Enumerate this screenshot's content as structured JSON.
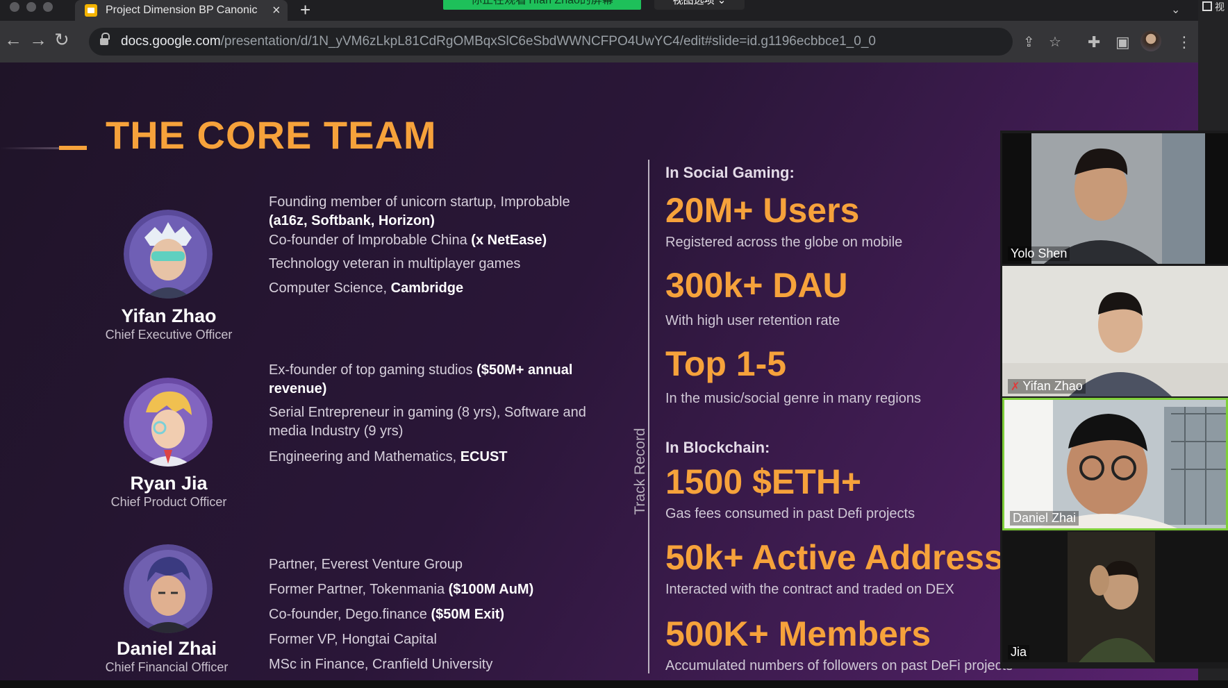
{
  "browser": {
    "tab_title": "Project Dimension BP Canonic",
    "tab_close": "×",
    "new_tab": "+",
    "share_banner": "你正在观看Yifan Zhao的屏幕",
    "view_options": "视图选项 ⌄",
    "url_host": "docs.google.com",
    "url_path": "/presentation/d/1N_yVM6zLkpL81CdRgOMBqxSlC6eSbdWWNCFPO4UwYC4/edit#slide=id.g1196ecbbce1_0_0",
    "right_strip_text": "视"
  },
  "slide": {
    "title": "THE CORE TEAM",
    "members": [
      {
        "name": "Yifan Zhao",
        "role": "Chief Executive Officer",
        "bullets": [
          {
            "text": "Founding member of unicorn startup, Improbable ",
            "bold": "(a16z, Softbank, Horizon)"
          },
          {
            "text": "Co-founder of Improbable China ",
            "bold": "(x NetEase)"
          },
          {
            "text": "Technology veteran in multiplayer games",
            "bold": ""
          },
          {
            "text": "Computer Science, ",
            "bold": "Cambridge"
          }
        ]
      },
      {
        "name": "Ryan Jia",
        "role": "Chief Product Officer",
        "bullets": [
          {
            "text": "Ex-founder of top gaming studios ",
            "bold": "($50M+ annual revenue)"
          },
          {
            "text": "Serial Entrepreneur in gaming (8 yrs), Software and media Industry (9 yrs)",
            "bold": ""
          },
          {
            "text": "Engineering and Mathematics, ",
            "bold": "ECUST"
          }
        ]
      },
      {
        "name": "Daniel Zhai",
        "role": "Chief Financial Officer",
        "bullets": [
          {
            "text": "Partner, Everest Venture Group",
            "bold": ""
          },
          {
            "text": "Former Partner, Tokenmania ",
            "bold": "($100M AuM)"
          },
          {
            "text": "Co-founder, Dego.finance ",
            "bold": "($50M Exit)"
          },
          {
            "text": "Former VP, Hongtai Capital",
            "bold": ""
          },
          {
            "text": "MSc in Finance, Cranfield University",
            "bold": ""
          }
        ]
      }
    ],
    "track_record_label": "Track Record",
    "social_heading": "In Social Gaming:",
    "blockchain_heading": "In Blockchain:",
    "stats": [
      {
        "big": "20M+ Users",
        "sub": "Registered across the globe on mobile"
      },
      {
        "big": "300k+ DAU",
        "sub": "With high user retention rate"
      },
      {
        "big": "Top 1-5",
        "sub": "In the music/social genre in many regions"
      },
      {
        "big": "1500 $ETH+",
        "sub": "Gas fees consumed in past Defi projects"
      },
      {
        "big": "50k+ Active Address",
        "sub": "Interacted with the contract and traded on DEX"
      },
      {
        "big": "500K+ Members",
        "sub": "Accumulated numbers of followers on past DeFi projects"
      }
    ]
  },
  "participants": [
    {
      "name": "Yolo Shen",
      "muted": false,
      "active": false
    },
    {
      "name": "Yifan Zhao",
      "muted": true,
      "active": false
    },
    {
      "name": "Daniel Zhai",
      "muted": false,
      "active": true
    },
    {
      "name": "Jia",
      "muted": false,
      "active": false
    }
  ],
  "colors": {
    "accent": "#f6a23b",
    "active_speaker": "#7fcf39",
    "share_banner": "#1ec05a"
  }
}
